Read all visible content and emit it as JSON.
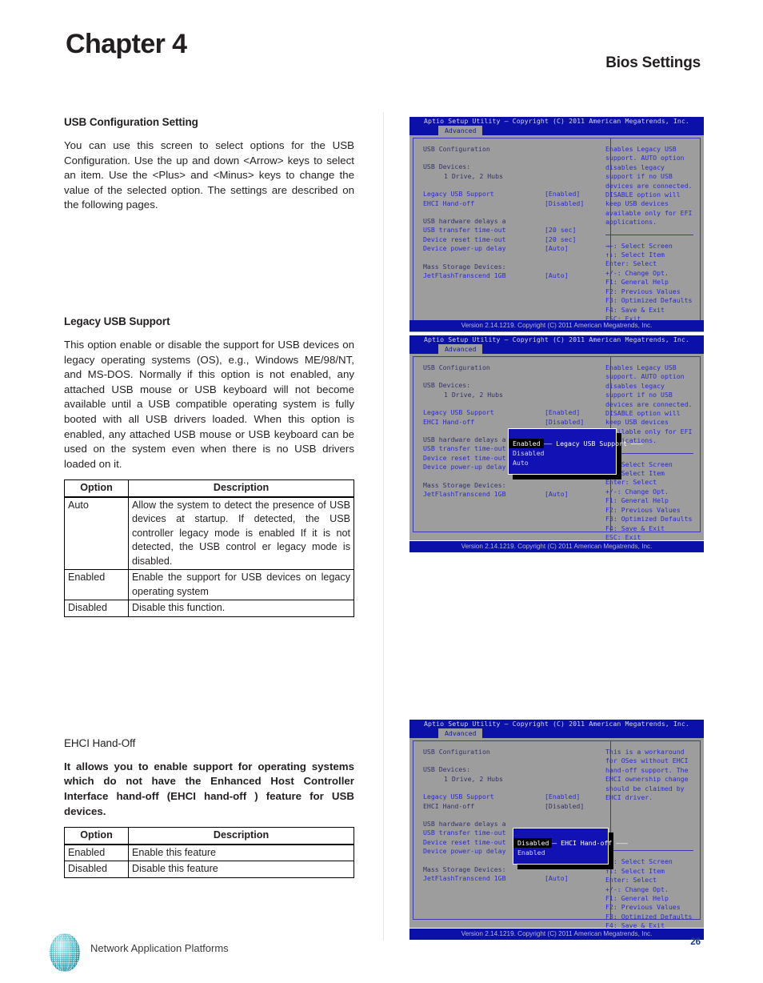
{
  "page": {
    "chapter": "Chapter 4",
    "section": "Bios Settings",
    "number": "26",
    "footer_brand": "Network Application Platforms"
  },
  "left": {
    "s1": {
      "heading": "USB Configuration Setting",
      "paragraph": "You can use this screen to select options for the USB Configuration. Use the up and down <Arrow> keys to select an item. Use the <Plus> and <Minus> keys to change the value of the selected option. The settings are described on the following pages."
    },
    "s2": {
      "heading": "Legacy USB Support",
      "paragraph": "This option enable or disable the support for USB devices on legacy operating systems (OS), e.g., Windows ME/98/NT, and MS-DOS. Normally if this option is not enabled, any attached USB mouse or USB keyboard will not become available until a USB compatible operating system is fully booted with all USB drivers loaded. When this option is enabled, any attached USB mouse or USB keyboard can be used on the system even when there is no USB drivers loaded on it.",
      "table": {
        "headers": [
          "Option",
          "Description"
        ],
        "rows": [
          [
            "Auto",
            "Allow the system to detect the presence of USB devices at startup. If detected, the USB controller legacy mode is enabled  If it is not detected, the USB control er legacy mode is disabled."
          ],
          [
            "Enabled",
            "Enable the support for USB devices on legacy operating system"
          ],
          [
            "Disabled",
            "Disable this function."
          ]
        ]
      }
    },
    "s3": {
      "heading": "EHCI Hand-Off",
      "paragraph": "It allows you to enable support for operating systems which do not have the Enhanced Host Controller Interface hand-off (EHCI hand-off ) feature for USB devices.",
      "table": {
        "headers": [
          "Option",
          "Description"
        ],
        "rows": [
          [
            "Enabled",
            "Enable this feature"
          ],
          [
            "Disabled",
            "Disable this feature"
          ]
        ]
      }
    }
  },
  "bios": {
    "common": {
      "titlebar": "Aptio Setup Utility – Copyright (C) 2011 American Megatrends, Inc.",
      "tab": "Advanced",
      "footer": "Version 2.14.1219. Copyright (C) 2011 American Megatrends, Inc.",
      "section_label": "USB Configuration",
      "devices_label": "USB Devices:",
      "devices_value": "1 Drive, 2 Hubs",
      "items": [
        {
          "label": "Legacy USB Support",
          "value": "[Enabled]"
        },
        {
          "label": "EHCI Hand-off",
          "value": "[Disabled]"
        }
      ],
      "delays_label": "USB hardware delays a",
      "delay_items": [
        {
          "label": "USB transfer time-out",
          "value": "[20 sec]"
        },
        {
          "label": "Device reset time-out",
          "value": "[20 sec]"
        },
        {
          "label": "Device power-up delay",
          "value": "[Auto]"
        }
      ],
      "mass_label": "Mass Storage Devices:",
      "mass_items": [
        {
          "label": "JetFlashTranscend 1GB",
          "value": "[Auto]"
        }
      ],
      "keys": [
        "→←: Select Screen",
        "↑↓: Select Item",
        "Enter: Select",
        "+/-: Change Opt.",
        "F1: General Help",
        "F2: Previous Values",
        "F3: Optimized Defaults",
        "F4: Save & Exit",
        "ESC: Exit"
      ]
    },
    "screen1": {
      "help": "Enables Legacy USB support. AUTO option disables legacy support if no USB devices are connected. DISABLE option will keep USB devices available only for EFI applications."
    },
    "screen2": {
      "help": "Enables Legacy USB support. AUTO option disables legacy support if no USB devices are connected. DISABLE option will keep USB devices available only for EFI applications.",
      "popup": {
        "title": "Legacy USB Support",
        "options": [
          "Enabled",
          "Disabled",
          "Auto"
        ],
        "selected_index": 0
      }
    },
    "screen3": {
      "help": "This is a workaround for OSes without EHCI hand-off support. The EHCI ownership change should be claimed by EHCI driver.",
      "popup": {
        "title": "EHCI Hand-off",
        "options": [
          "Disabled",
          "Enabled"
        ],
        "selected_index": 0
      }
    }
  },
  "colors": {
    "bios_header": "#0a10a8",
    "bios_body": "#9d9d9d",
    "bios_text": "#2a2ad0",
    "popup_bg": "#1111b4",
    "brand_teal": "#2fa8b5",
    "page_num": "#1b3a8f"
  }
}
